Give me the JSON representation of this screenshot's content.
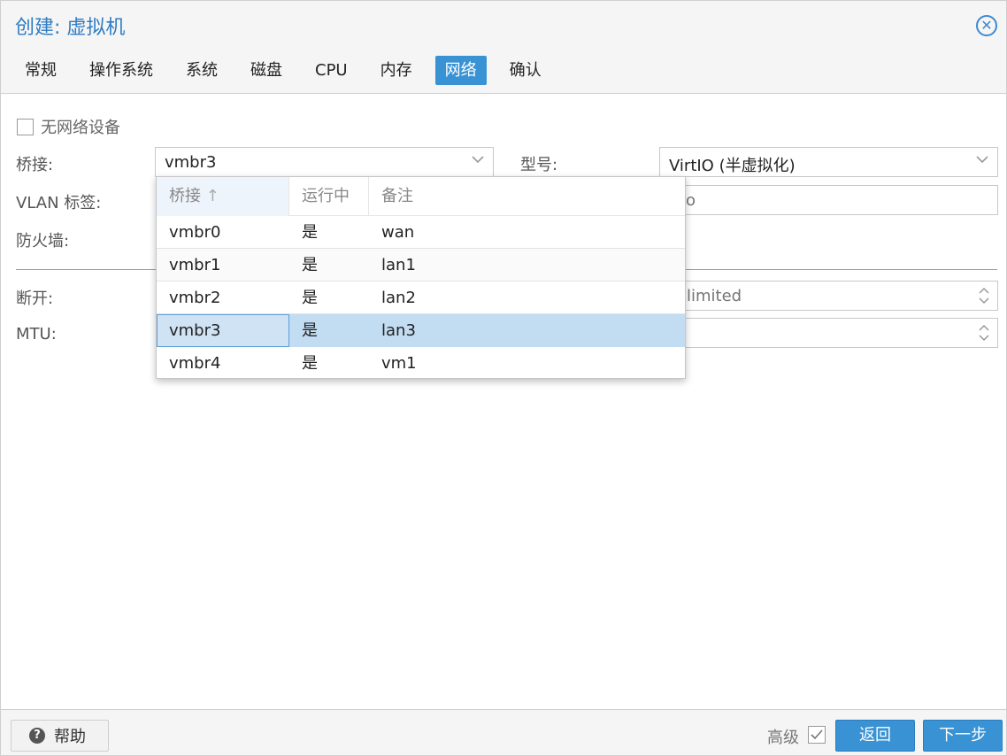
{
  "window": {
    "title": "创建: 虚拟机"
  },
  "tabs": [
    {
      "label": "常规"
    },
    {
      "label": "操作系统"
    },
    {
      "label": "系统"
    },
    {
      "label": "磁盘"
    },
    {
      "label": "CPU"
    },
    {
      "label": "内存"
    },
    {
      "label": "网络",
      "active": true
    },
    {
      "label": "确认"
    }
  ],
  "form": {
    "no_network_label": "无网络设备",
    "no_network_checked": false,
    "bridge_label": "桥接:",
    "bridge_value": "vmbr3",
    "model_label": "型号:",
    "model_value": "VirtIO (半虚拟化)",
    "vlan_label": "VLAN 标签:",
    "vlan_placeholder": "to",
    "firewall_label": "防火墙:",
    "disconnect_label": "断开:",
    "rate_placeholder": "limited",
    "mtu_label": "MTU:"
  },
  "bridge_dropdown": {
    "columns": [
      "桥接",
      "运行中",
      "备注"
    ],
    "sort_indicator": "↑",
    "rows": [
      {
        "bridge": "vmbr0",
        "active": "是",
        "comment": "wan"
      },
      {
        "bridge": "vmbr1",
        "active": "是",
        "comment": "lan1"
      },
      {
        "bridge": "vmbr2",
        "active": "是",
        "comment": "lan2"
      },
      {
        "bridge": "vmbr3",
        "active": "是",
        "comment": "lan3",
        "selected": true
      },
      {
        "bridge": "vmbr4",
        "active": "是",
        "comment": "vm1"
      }
    ]
  },
  "footer": {
    "help_label": "帮助",
    "advanced_label": "高级",
    "advanced_checked": true,
    "back_label": "返回",
    "next_label": "下一步"
  },
  "colors": {
    "accent": "#3892d4",
    "title": "#2f7cc3",
    "selected_row": "#c2dcf2"
  },
  "icons": {
    "close": "close-circle-icon",
    "dropdown_trigger": "chevron-down-icon",
    "spinner": "spinner-arrows-icon",
    "help": "question-circle-icon",
    "check": "checkmark-icon"
  }
}
